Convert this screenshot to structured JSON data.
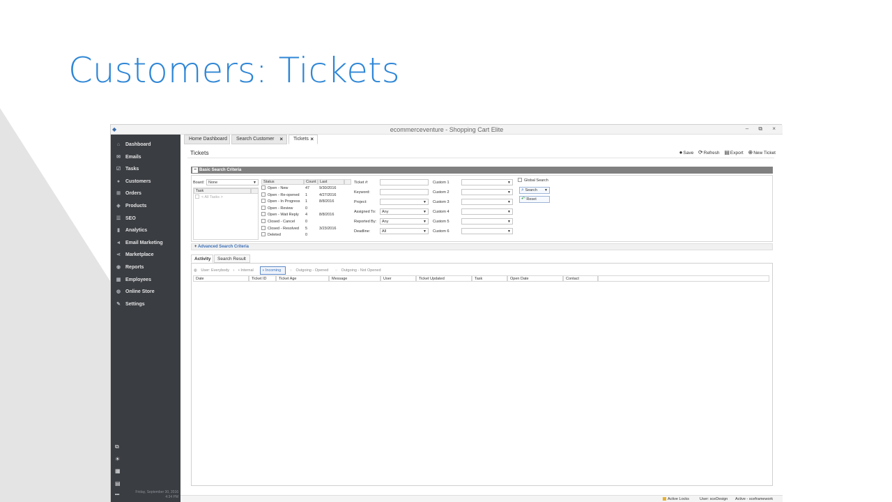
{
  "slide": {
    "title": "Customers: Tickets"
  },
  "window": {
    "title": "ecommerceventure - Shopping Cart Elite",
    "controls": "– ⧉ ×"
  },
  "sidebar": {
    "items": [
      {
        "label": "Dashboard",
        "icon": "home-icon",
        "glyph": "⌂"
      },
      {
        "label": "Emails",
        "icon": "mail-icon",
        "glyph": "✉"
      },
      {
        "label": "Tasks",
        "icon": "tasks-icon",
        "glyph": "☑"
      },
      {
        "label": "Customers",
        "icon": "user-icon",
        "glyph": "●"
      },
      {
        "label": "Orders",
        "icon": "cart-icon",
        "glyph": "⊞"
      },
      {
        "label": "Products",
        "icon": "tag-icon",
        "glyph": "◈"
      },
      {
        "label": "SEO",
        "icon": "list-icon",
        "glyph": "☰"
      },
      {
        "label": "Analytics",
        "icon": "bar-chart-icon",
        "glyph": "▮"
      },
      {
        "label": "Email Marketing",
        "icon": "megaphone-icon",
        "glyph": "◄"
      },
      {
        "label": "Marketplace",
        "icon": "share-icon",
        "glyph": "⋖"
      },
      {
        "label": "Reports",
        "icon": "gauge-icon",
        "glyph": "◉"
      },
      {
        "label": "Employees",
        "icon": "team-icon",
        "glyph": "▦"
      },
      {
        "label": "Online Store",
        "icon": "globe-icon",
        "glyph": "◍"
      },
      {
        "label": "Settings",
        "icon": "wrench-icon",
        "glyph": "✎"
      }
    ],
    "bottom_icons": [
      "window-icon",
      "bulb-icon",
      "calculator-icon",
      "calendar-icon",
      "more-icon"
    ],
    "date": "Friday, September 30, 2016",
    "time": "4:34 PM"
  },
  "tabs": [
    {
      "label": "Home Dashboard"
    },
    {
      "label": "Search Customer",
      "close": "×"
    },
    {
      "label": "Tickets",
      "close": "×"
    }
  ],
  "page_title": "Tickets",
  "toolbar": {
    "save": "Save",
    "refresh": "Refresh",
    "export": "Export",
    "new_ticket": "New Ticket"
  },
  "basic_search": {
    "header": "Basic Search Criteria",
    "toggle": "−",
    "board_label": "Board:",
    "board_value": "None",
    "task_header": "Task",
    "task_all": "< All Tasks >",
    "status_headers": {
      "status": "Status",
      "count": "Count",
      "last": "Last"
    },
    "statuses": [
      {
        "name": "Open - New",
        "count": "47",
        "last": "9/30/2016"
      },
      {
        "name": "Open - Re-opened",
        "count": "1",
        "last": "4/27/2016"
      },
      {
        "name": "Open - In Progress",
        "count": "1",
        "last": "8/8/2016"
      },
      {
        "name": "Open - Review",
        "count": "0",
        "last": ""
      },
      {
        "name": "Open - Wait Reply",
        "count": "4",
        "last": "8/8/2016"
      },
      {
        "name": "Closed - Cancel",
        "count": "0",
        "last": ""
      },
      {
        "name": "Closed - Resolved",
        "count": "5",
        "last": "3/23/2016"
      },
      {
        "name": "Deleted",
        "count": "0",
        "last": ""
      }
    ],
    "fields": {
      "ticket_label": "Ticket #:",
      "keyword_label": "Keyword:",
      "project_label": "Project:",
      "assigned_label": "Assigned To:",
      "assigned_value": "Any",
      "reported_label": "Reported By:",
      "reported_value": "Any",
      "deadline_label": "Deadline:",
      "deadline_value": "All"
    },
    "custom": [
      "Custom 1",
      "Custom 2",
      "Custom 3",
      "Custom 4",
      "Custom 5",
      "Custom 6"
    ],
    "global_search": "Global Search",
    "search_btn": "Search",
    "reset_btn": "Reset"
  },
  "advanced": {
    "toggle": "+",
    "label": "Advanced Search Criteria"
  },
  "subtabs": [
    {
      "label": "Activity"
    },
    {
      "label": "Search Result"
    }
  ],
  "filters": {
    "user": "User: Everybody",
    "internal": "Internal",
    "incoming": "Incoming",
    "outgoing_opened": "Outgoing - Opened",
    "outgoing_not_opened": "Outgoing - Not Opened"
  },
  "columns": [
    "Date",
    "Ticket ID",
    "Ticket Age",
    "Message",
    "User",
    "Ticket Updated",
    "Task",
    "Open Date",
    "Contact"
  ],
  "statusbar": {
    "locks": "Active Locks",
    "user": "User: sceDesign",
    "active": "Active - sceframework"
  }
}
